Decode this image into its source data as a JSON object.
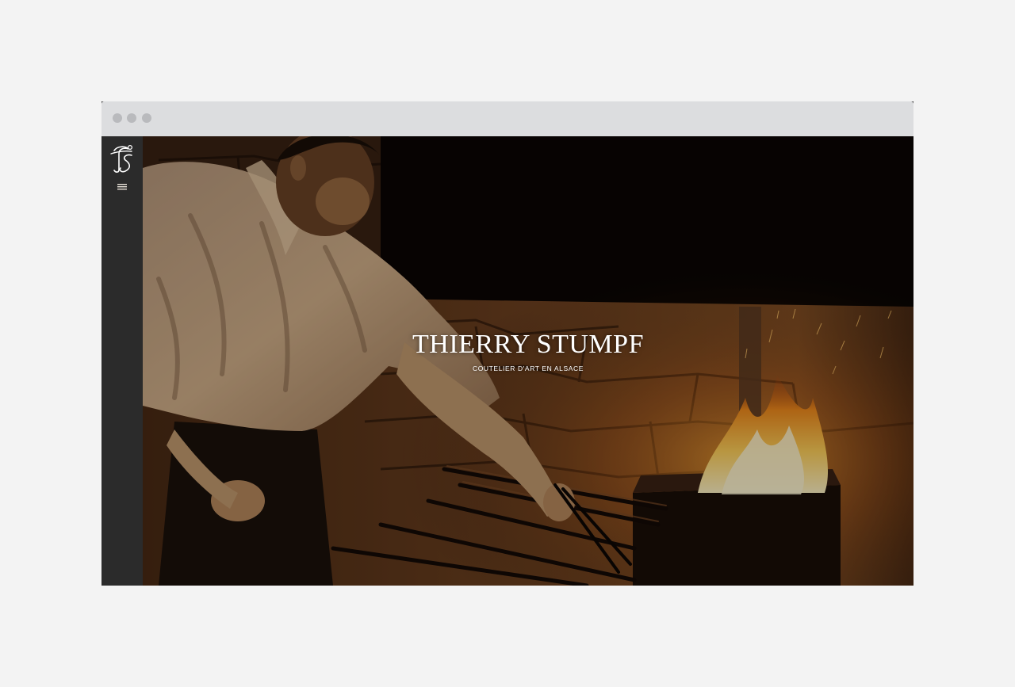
{
  "page": {
    "background": "#f3f3f3"
  },
  "browser": {
    "chrome_color": "#dcdddf",
    "dot_color": "#b9babd"
  },
  "sidebar": {
    "background": "#2b2b2b",
    "logo_icon": "ts-monogram-icon",
    "menu_icon": "hamburger-menu-icon"
  },
  "hero": {
    "title": "THIERRY STUMPF",
    "subtitle": "COUTELIER D'ART EN ALSACE",
    "image": "blacksmith-at-forge-photo",
    "accent_fire": "#f7a531"
  }
}
